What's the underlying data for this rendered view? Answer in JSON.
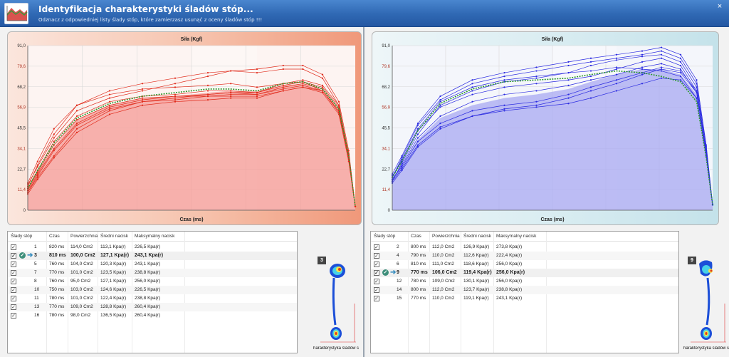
{
  "window": {
    "title": "Identyfikacja charakterystyki śladów stóp...",
    "subtitle": "Odznacz z odpowiedniej listy ślady stóp, które zamierzasz usunąć z oceny śladów stóp !!!",
    "close_label": "×"
  },
  "colors": {
    "left_series": "#e02a1a",
    "left_fill": "#f49a94",
    "right_series": "#2a2ae0",
    "right_fill": "#a8a8f2",
    "mean_line": "#2e9a2e"
  },
  "chart_data": [
    {
      "type": "line",
      "title": "Siła (Kgf)",
      "xlabel": "Czas (ms)",
      "ylabel": "",
      "ylim": [
        0,
        91.0
      ],
      "yticks": [
        "91,0",
        "79,6",
        "68,2",
        "56,9",
        "45,5",
        "34,1",
        "22,7",
        "11,4",
        "0"
      ],
      "x": [
        0,
        0.03,
        0.08,
        0.15,
        0.25,
        0.35,
        0.45,
        0.55,
        0.62,
        0.7,
        0.78,
        0.84,
        0.9,
        0.95,
        0.98,
        1.0
      ],
      "series": [
        {
          "values": [
            12,
            22,
            38,
            52,
            60,
            63,
            64,
            66,
            66,
            65,
            70,
            71,
            66,
            55,
            30,
            2
          ]
        },
        {
          "values": [
            14,
            24,
            40,
            55,
            62,
            66,
            70,
            74,
            77,
            78,
            80,
            80,
            75,
            60,
            33,
            2
          ]
        },
        {
          "values": [
            10,
            18,
            30,
            45,
            55,
            60,
            62,
            64,
            65,
            64,
            68,
            70,
            67,
            56,
            28,
            2
          ]
        },
        {
          "values": [
            13,
            25,
            42,
            58,
            66,
            70,
            73,
            76,
            77,
            76,
            78,
            78,
            73,
            58,
            30,
            2
          ]
        },
        {
          "values": [
            11,
            20,
            34,
            48,
            57,
            61,
            63,
            63,
            64,
            64,
            67,
            69,
            66,
            54,
            29,
            2
          ]
        },
        {
          "values": [
            12,
            21,
            36,
            50,
            58,
            62,
            63,
            64,
            65,
            65,
            69,
            71,
            68,
            57,
            31,
            2
          ]
        },
        {
          "values": [
            9,
            17,
            29,
            43,
            53,
            58,
            60,
            61,
            62,
            62,
            66,
            68,
            65,
            53,
            27,
            2
          ]
        },
        {
          "values": [
            15,
            27,
            45,
            58,
            64,
            67,
            68,
            69,
            70,
            68,
            70,
            72,
            69,
            58,
            31,
            2
          ]
        },
        {
          "values": [
            10,
            19,
            33,
            47,
            56,
            60,
            61,
            63,
            63,
            63,
            66,
            68,
            66,
            55,
            30,
            2
          ]
        }
      ],
      "mean": [
        12,
        22,
        37,
        51,
        59,
        63,
        65,
        67,
        67,
        66,
        70,
        71,
        67,
        56,
        30,
        2
      ],
      "fill": [
        12,
        21,
        35,
        50,
        58,
        62,
        63,
        65,
        66,
        66,
        69,
        70,
        66,
        55,
        29,
        2
      ]
    },
    {
      "type": "line",
      "title": "Siła (Kgf)",
      "xlabel": "Czas (ms)",
      "ylabel": "",
      "ylim": [
        0,
        91.0
      ],
      "yticks": [
        "91,0",
        "79,6",
        "68,2",
        "56,9",
        "45,5",
        "34,1",
        "22,7",
        "11,4",
        "0"
      ],
      "x": [
        0,
        0.03,
        0.08,
        0.15,
        0.25,
        0.35,
        0.45,
        0.55,
        0.62,
        0.7,
        0.78,
        0.84,
        0.9,
        0.95,
        0.98,
        1.0
      ],
      "series": [
        {
          "values": [
            18,
            28,
            45,
            60,
            68,
            72,
            74,
            76,
            77,
            79,
            78,
            77,
            74,
            62,
            30,
            3
          ]
        },
        {
          "values": [
            16,
            26,
            42,
            58,
            66,
            71,
            73,
            76,
            80,
            83,
            85,
            86,
            82,
            68,
            33,
            3
          ]
        },
        {
          "values": [
            20,
            30,
            48,
            63,
            72,
            76,
            79,
            82,
            84,
            86,
            88,
            90,
            86,
            72,
            36,
            3
          ]
        },
        {
          "values": [
            15,
            22,
            35,
            45,
            52,
            56,
            58,
            62,
            66,
            70,
            75,
            78,
            76,
            65,
            32,
            3
          ]
        },
        {
          "values": [
            17,
            24,
            38,
            48,
            55,
            58,
            60,
            64,
            68,
            72,
            76,
            79,
            77,
            66,
            33,
            3
          ]
        },
        {
          "values": [
            19,
            27,
            44,
            57,
            64,
            68,
            70,
            72,
            74,
            78,
            82,
            84,
            80,
            66,
            32,
            3
          ]
        },
        {
          "values": [
            16,
            23,
            36,
            46,
            52,
            55,
            57,
            59,
            62,
            66,
            70,
            73,
            72,
            62,
            30,
            3
          ]
        },
        {
          "values": [
            18,
            29,
            47,
            61,
            70,
            74,
            77,
            80,
            82,
            84,
            86,
            88,
            84,
            70,
            35,
            3
          ]
        },
        {
          "values": [
            17,
            25,
            40,
            52,
            60,
            64,
            66,
            69,
            72,
            75,
            79,
            81,
            78,
            65,
            32,
            3
          ]
        }
      ],
      "mean": [
        18,
        27,
        44,
        59,
        67,
        71,
        72,
        73,
        75,
        77,
        76,
        74,
        71,
        60,
        29,
        3
      ],
      "fill": [
        17,
        25,
        39,
        51,
        58,
        62,
        64,
        67,
        71,
        75,
        78,
        78,
        75,
        64,
        31,
        3
      ]
    }
  ],
  "left_table": {
    "headers": [
      "Ślady stóp",
      "Czas",
      "Powierzchnia",
      "Średni nacisk",
      "Maksymalny nacisk"
    ],
    "rows": [
      {
        "num": "1",
        "czas": "820 ms",
        "pow": "114,0 Cm2",
        "sred": "113,1 Kpa(r)",
        "max": "226,5 Kpa(r)",
        "sel": false
      },
      {
        "num": "3",
        "czas": "810 ms",
        "pow": "100,0 Cm2",
        "sred": "127,1 Kpa(r)",
        "max": "243,1 Kpa(r)",
        "sel": true
      },
      {
        "num": "5",
        "czas": "760 ms",
        "pow": "104,0 Cm2",
        "sred": "120,3 Kpa(r)",
        "max": "243,1 Kpa(r)",
        "sel": false
      },
      {
        "num": "7",
        "czas": "770 ms",
        "pow": "101,0 Cm2",
        "sred": "123,5 Kpa(r)",
        "max": "238,8 Kpa(r)",
        "sel": false
      },
      {
        "num": "8",
        "czas": "760 ms",
        "pow": "95,0 Cm2",
        "sred": "127,1 Kpa(r)",
        "max": "256,0 Kpa(r)",
        "sel": false
      },
      {
        "num": "10",
        "czas": "750 ms",
        "pow": "103,0 Cm2",
        "sred": "124,6 Kpa(r)",
        "max": "226,5 Kpa(r)",
        "sel": false
      },
      {
        "num": "11",
        "czas": "780 ms",
        "pow": "101,0 Cm2",
        "sred": "122,4 Kpa(r)",
        "max": "238,8 Kpa(r)",
        "sel": false
      },
      {
        "num": "13",
        "czas": "770 ms",
        "pow": "109,0 Cm2",
        "sred": "128,8 Kpa(r)",
        "max": "260,4 Kpa(r)",
        "sel": false
      },
      {
        "num": "16",
        "czas": "780 ms",
        "pow": "98,0 Cm2",
        "sred": "136,5 Kpa(r)",
        "max": "260,4 Kpa(r)",
        "sel": false
      }
    ]
  },
  "right_table": {
    "headers": [
      "Ślady stóp",
      "Czas",
      "Powierzchnia",
      "Średni nacisk",
      "Maksymalny nacisk"
    ],
    "rows": [
      {
        "num": "2",
        "czas": "800 ms",
        "pow": "112,0 Cm2",
        "sred": "126,9 Kpa(r)",
        "max": "273,8 Kpa(r)",
        "sel": false
      },
      {
        "num": "4",
        "czas": "790 ms",
        "pow": "110,0 Cm2",
        "sred": "112,6 Kpa(r)",
        "max": "222,4 Kpa(r)",
        "sel": false
      },
      {
        "num": "6",
        "czas": "810 ms",
        "pow": "111,0 Cm2",
        "sred": "118,6 Kpa(r)",
        "max": "256,0 Kpa(r)",
        "sel": false
      },
      {
        "num": "9",
        "czas": "770 ms",
        "pow": "106,0 Cm2",
        "sred": "119,4 Kpa(r)",
        "max": "256,0 Kpa(r)",
        "sel": true
      },
      {
        "num": "12",
        "czas": "780 ms",
        "pow": "109,0 Cm2",
        "sred": "130,1 Kpa(r)",
        "max": "256,0 Kpa(r)",
        "sel": false
      },
      {
        "num": "14",
        "czas": "800 ms",
        "pow": "112,0 Cm2",
        "sred": "123,7 Kpa(r)",
        "max": "238,8 Kpa(r)",
        "sel": false
      },
      {
        "num": "15",
        "czas": "770 ms",
        "pow": "110,0 Cm2",
        "sred": "119,1 Kpa(r)",
        "max": "243,1 Kpa(r)",
        "sel": false
      }
    ]
  },
  "left_footprint": {
    "badge": "3",
    "caption": "harakterystyka śladów stó"
  },
  "right_footprint": {
    "badge": "9",
    "caption": "harakterystyka śladów stó"
  }
}
